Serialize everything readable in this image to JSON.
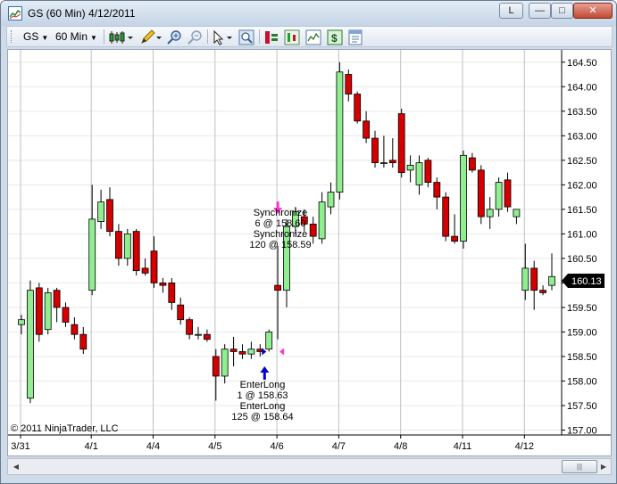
{
  "window": {
    "title": "GS (60 Min)  4/12/2011",
    "buttons": {
      "layout": "L",
      "minimize": "—",
      "maximize": "□",
      "close": "✕"
    }
  },
  "toolbar": {
    "instrument": "GS",
    "interval": "60 Min",
    "icons": [
      "candlestick-style-icon",
      "pencil-draw-icon",
      "zoom-in-icon",
      "zoom-out-icon",
      "cursor-icon",
      "magnifier-icon",
      "data-box-icon",
      "chart-trader-icon",
      "indicators-icon",
      "strategies-icon",
      "properties-icon"
    ]
  },
  "colors": {
    "up_candle": "#90ee90",
    "down_candle": "#d40000",
    "grid": "#c0c0c0",
    "price_marker_bg": "#000000",
    "sync_marker": "#ff33cc",
    "entry_marker": "#0000cc"
  },
  "chart": {
    "copyright": "© 2011 NinjaTrader, LLC",
    "price_labels": [
      "164.50",
      "164.00",
      "163.50",
      "163.00",
      "162.50",
      "162.00",
      "161.50",
      "161.00",
      "160.50",
      "160.00",
      "159.50",
      "159.00",
      "158.50",
      "158.00",
      "157.50",
      "157.00"
    ],
    "date_labels": [
      "3/31",
      "4/1",
      "4/4",
      "4/5",
      "4/6",
      "4/7",
      "4/8",
      "4/11",
      "4/12"
    ],
    "last_price": "160.13",
    "annotations": {
      "sync": [
        "Synchronize",
        "6 @ 158.60",
        "Synchronize",
        "120 @ 158.59"
      ],
      "entry": [
        "EnterLong",
        "1 @ 158.63",
        "EnterLong",
        "125 @ 158.64"
      ]
    }
  },
  "chart_data": {
    "type": "candlestick",
    "title": "GS (60 Min)  4/12/2011",
    "y_range": [
      156.9,
      164.75
    ],
    "last_price": 160.13,
    "session_dates": [
      "3/31",
      "4/1",
      "4/4",
      "4/5",
      "4/6",
      "4/7",
      "4/8",
      "4/11",
      "4/12"
    ],
    "session_start_index": [
      0,
      8,
      15,
      22,
      29,
      36,
      43,
      50,
      57
    ],
    "candles": [
      {
        "o": 159.15,
        "h": 159.35,
        "l": 158.95,
        "c": 159.25
      },
      {
        "o": 157.65,
        "h": 160.05,
        "l": 157.55,
        "c": 159.85
      },
      {
        "o": 159.9,
        "h": 160.0,
        "l": 158.8,
        "c": 158.95
      },
      {
        "o": 159.05,
        "h": 159.9,
        "l": 158.95,
        "c": 159.8
      },
      {
        "o": 159.85,
        "h": 159.9,
        "l": 159.2,
        "c": 159.5
      },
      {
        "o": 159.5,
        "h": 159.6,
        "l": 159.1,
        "c": 159.2
      },
      {
        "o": 159.15,
        "h": 159.3,
        "l": 158.85,
        "c": 158.95
      },
      {
        "o": 158.95,
        "h": 159.1,
        "l": 158.55,
        "c": 158.65
      },
      {
        "o": 159.85,
        "h": 162.0,
        "l": 159.75,
        "c": 161.3
      },
      {
        "o": 161.25,
        "h": 161.9,
        "l": 161.1,
        "c": 161.65
      },
      {
        "o": 161.7,
        "h": 161.95,
        "l": 160.95,
        "c": 161.05
      },
      {
        "o": 161.05,
        "h": 161.2,
        "l": 160.35,
        "c": 160.5
      },
      {
        "o": 160.5,
        "h": 161.1,
        "l": 160.35,
        "c": 161.0
      },
      {
        "o": 161.05,
        "h": 161.1,
        "l": 160.15,
        "c": 160.25
      },
      {
        "o": 160.3,
        "h": 160.5,
        "l": 160.15,
        "c": 160.2
      },
      {
        "o": 160.65,
        "h": 160.95,
        "l": 159.9,
        "c": 160.0
      },
      {
        "o": 160.0,
        "h": 160.1,
        "l": 159.8,
        "c": 159.95
      },
      {
        "o": 160.0,
        "h": 160.1,
        "l": 159.45,
        "c": 159.6
      },
      {
        "o": 159.55,
        "h": 159.7,
        "l": 159.15,
        "c": 159.25
      },
      {
        "o": 159.25,
        "h": 159.3,
        "l": 158.85,
        "c": 158.95
      },
      {
        "o": 158.95,
        "h": 159.1,
        "l": 158.85,
        "c": 158.95
      },
      {
        "o": 158.95,
        "h": 159.05,
        "l": 158.8,
        "c": 158.85
      },
      {
        "o": 158.5,
        "h": 158.65,
        "l": 157.6,
        "c": 158.1
      },
      {
        "o": 158.1,
        "h": 158.75,
        "l": 157.95,
        "c": 158.65
      },
      {
        "o": 158.65,
        "h": 158.9,
        "l": 158.3,
        "c": 158.6
      },
      {
        "o": 158.6,
        "h": 158.75,
        "l": 158.45,
        "c": 158.55
      },
      {
        "o": 158.55,
        "h": 158.8,
        "l": 158.45,
        "c": 158.65
      },
      {
        "o": 158.65,
        "h": 158.75,
        "l": 158.5,
        "c": 158.6
      },
      {
        "o": 158.65,
        "h": 159.05,
        "l": 158.6,
        "c": 159.0
      },
      {
        "o": 159.95,
        "h": 160.75,
        "l": 158.85,
        "c": 159.85
      },
      {
        "o": 159.85,
        "h": 161.3,
        "l": 159.5,
        "c": 161.15
      },
      {
        "o": 161.15,
        "h": 161.55,
        "l": 161.0,
        "c": 161.45
      },
      {
        "o": 161.35,
        "h": 161.5,
        "l": 161.05,
        "c": 161.2
      },
      {
        "o": 161.2,
        "h": 161.35,
        "l": 160.8,
        "c": 160.95
      },
      {
        "o": 160.9,
        "h": 161.85,
        "l": 160.8,
        "c": 161.65
      },
      {
        "o": 161.55,
        "h": 162.05,
        "l": 161.4,
        "c": 161.85
      },
      {
        "o": 161.85,
        "h": 164.5,
        "l": 161.7,
        "c": 164.3
      },
      {
        "o": 164.25,
        "h": 164.35,
        "l": 163.7,
        "c": 163.85
      },
      {
        "o": 163.85,
        "h": 163.9,
        "l": 163.25,
        "c": 163.3
      },
      {
        "o": 163.3,
        "h": 163.5,
        "l": 162.85,
        "c": 162.95
      },
      {
        "o": 162.95,
        "h": 163.1,
        "l": 162.35,
        "c": 162.45
      },
      {
        "o": 162.45,
        "h": 163.0,
        "l": 162.35,
        "c": 162.45
      },
      {
        "o": 162.5,
        "h": 162.95,
        "l": 162.35,
        "c": 162.45
      },
      {
        "o": 163.45,
        "h": 163.55,
        "l": 162.15,
        "c": 162.25
      },
      {
        "o": 162.3,
        "h": 162.6,
        "l": 162.05,
        "c": 162.4
      },
      {
        "o": 162.0,
        "h": 162.6,
        "l": 161.8,
        "c": 162.45
      },
      {
        "o": 162.5,
        "h": 162.55,
        "l": 161.95,
        "c": 162.05
      },
      {
        "o": 162.05,
        "h": 162.15,
        "l": 161.5,
        "c": 161.75
      },
      {
        "o": 161.75,
        "h": 161.85,
        "l": 160.85,
        "c": 160.95
      },
      {
        "o": 160.95,
        "h": 161.4,
        "l": 160.8,
        "c": 160.85
      },
      {
        "o": 160.85,
        "h": 162.7,
        "l": 160.7,
        "c": 162.6
      },
      {
        "o": 162.55,
        "h": 162.65,
        "l": 162.25,
        "c": 162.3
      },
      {
        "o": 162.3,
        "h": 162.4,
        "l": 161.2,
        "c": 161.35
      },
      {
        "o": 161.35,
        "h": 161.75,
        "l": 161.1,
        "c": 161.5
      },
      {
        "o": 161.5,
        "h": 162.15,
        "l": 161.35,
        "c": 162.05
      },
      {
        "o": 162.1,
        "h": 162.25,
        "l": 161.45,
        "c": 161.55
      },
      {
        "o": 161.35,
        "h": 161.5,
        "l": 161.2,
        "c": 161.5
      },
      {
        "o": 159.85,
        "h": 160.8,
        "l": 159.65,
        "c": 160.3
      },
      {
        "o": 160.3,
        "h": 160.45,
        "l": 159.45,
        "c": 159.85
      },
      {
        "o": 159.85,
        "h": 159.95,
        "l": 159.75,
        "c": 159.8
      },
      {
        "o": 159.95,
        "h": 160.6,
        "l": 159.85,
        "c": 160.13
      }
    ],
    "markers": {
      "sync_candle_index": 29,
      "entry_candle_index": 27
    }
  }
}
